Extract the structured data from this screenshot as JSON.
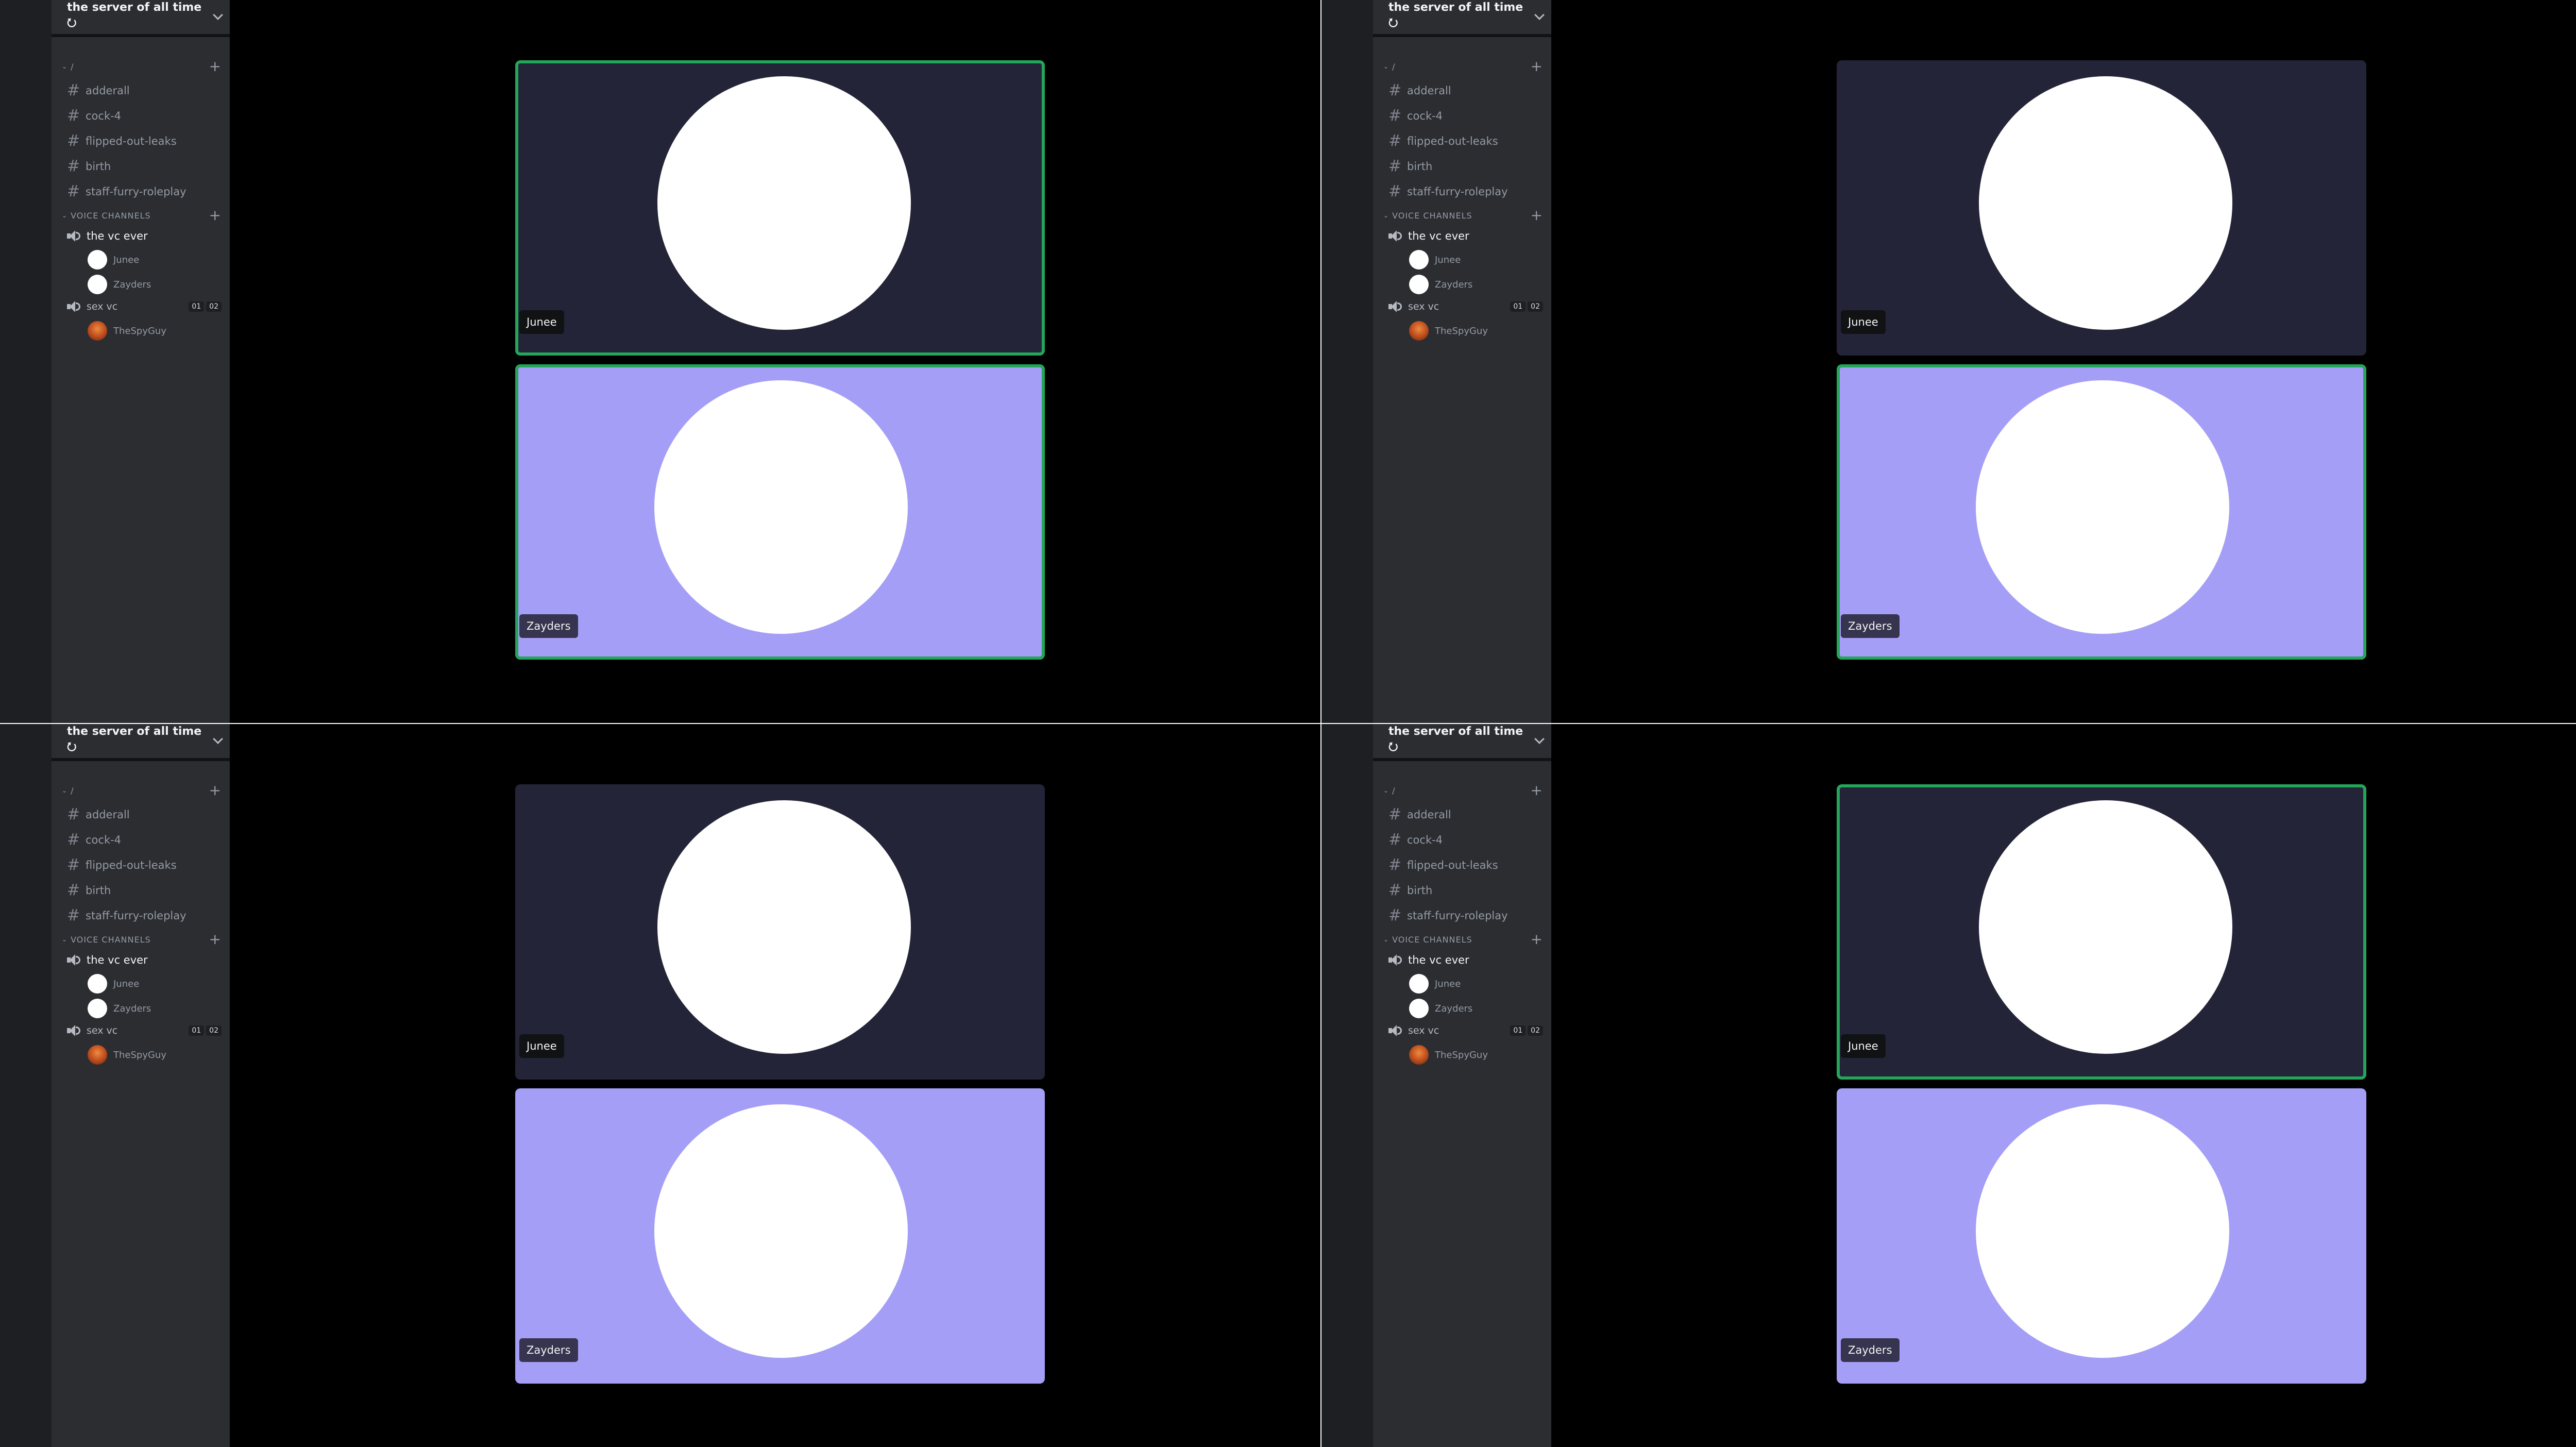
{
  "server": {
    "name": "the server of all time ⭮"
  },
  "categories": {
    "text_name": "/",
    "voice_name": "VOICE CHANNELS"
  },
  "text_channels": [
    "adderall",
    "cock-4",
    "flipped-out-leaks",
    "birth",
    "staff-furry-roleplay"
  ],
  "voice": {
    "channel1": {
      "name": "the vc ever",
      "users": [
        "Junee",
        "Zayders"
      ]
    },
    "channel2": {
      "name": "sex vc",
      "count_current": "01",
      "count_limit": "02",
      "users": [
        "TheSpyGuy"
      ]
    }
  },
  "tiles": {
    "top_name": "Junee",
    "bottom_name": "Zayders"
  },
  "panels": [
    {
      "speaking": [
        "top",
        "bottom"
      ]
    },
    {
      "speaking": [
        "bottom"
      ]
    },
    {
      "speaking": []
    },
    {
      "speaking": [
        "top"
      ]
    }
  ],
  "colors": {
    "speaking_ring": "#23a55a",
    "top_tile_bg": "#232437",
    "bottom_tile_bg": "#a59ef7"
  },
  "icons": {
    "text_channel": "hash-icon",
    "voice_channel": "speaker-icon",
    "header_menu": "chevron-down-icon",
    "create": "plus-icon"
  }
}
